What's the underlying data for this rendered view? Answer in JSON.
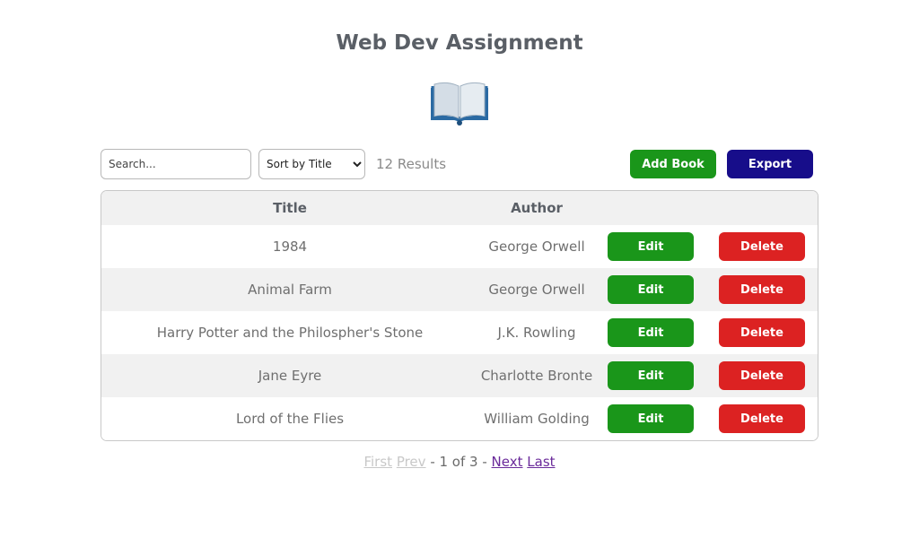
{
  "page": {
    "title": "Web Dev Assignment",
    "logo_icon": "open-book-icon"
  },
  "toolbar": {
    "search_placeholder": "Search...",
    "search_value": "",
    "sort_selected": "Sort by Title",
    "results_text": "12 Results",
    "add_label": "Add Book",
    "export_label": "Export"
  },
  "table": {
    "headers": {
      "title": "Title",
      "author": "Author"
    },
    "rows": [
      {
        "title": "1984",
        "author": "George Orwell",
        "edit_label": "Edit",
        "delete_label": "Delete"
      },
      {
        "title": "Animal Farm",
        "author": "George Orwell",
        "edit_label": "Edit",
        "delete_label": "Delete"
      },
      {
        "title": "Harry Potter and the Philospher's Stone",
        "author": "J.K. Rowling",
        "edit_label": "Edit",
        "delete_label": "Delete"
      },
      {
        "title": "Jane Eyre",
        "author": "Charlotte Bronte",
        "edit_label": "Edit",
        "delete_label": "Delete"
      },
      {
        "title": "Lord of the Flies",
        "author": "William Golding",
        "edit_label": "Edit",
        "delete_label": "Delete"
      }
    ]
  },
  "pagination": {
    "first": "First",
    "prev": "Prev",
    "separator_left": " - ",
    "status": "1 of 3",
    "separator_right": " - ",
    "next": "Next",
    "last": "Last"
  },
  "colors": {
    "add_button": "#1a961a",
    "export_button": "#170d8a",
    "edit_button": "#1a961a",
    "delete_button": "#dc2222",
    "link_visited": "#6a2a9a",
    "link_disabled": "#c8c8c8"
  }
}
